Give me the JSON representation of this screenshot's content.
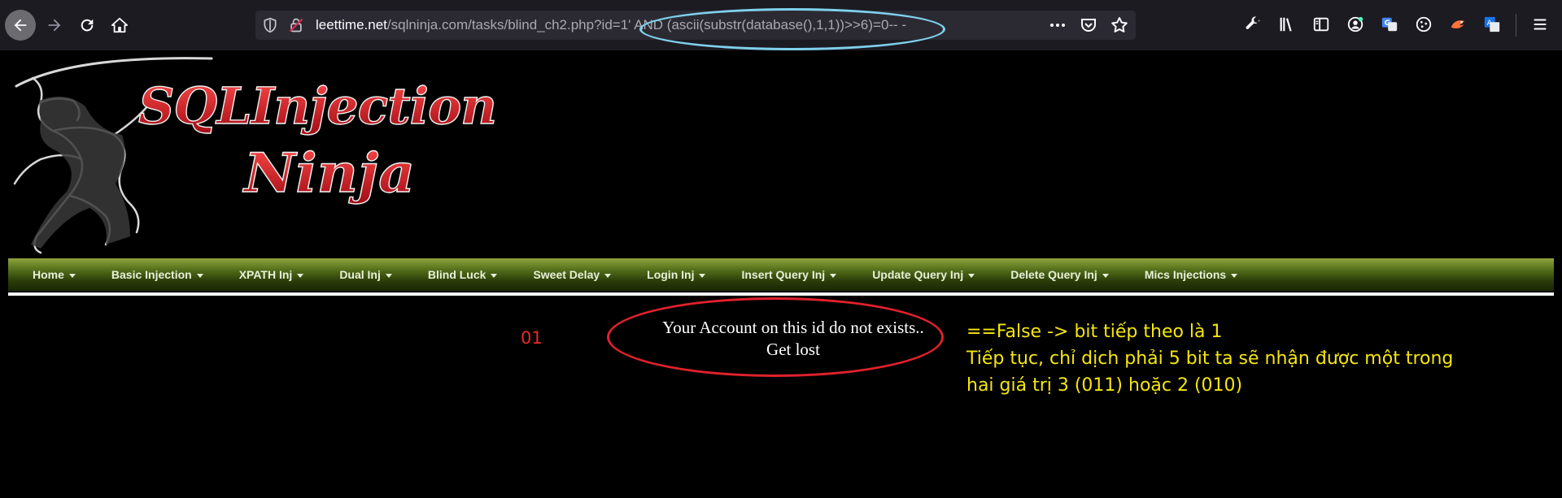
{
  "browser": {
    "url_host": "leettime.net",
    "url_path": "/sqlninja.com/tasks/blind_ch2.php?id=1' AND (ascii(substr(database(),1,1))>>6)=0-- -",
    "icons": {
      "back": "arrow-left-icon",
      "forward": "arrow-right-icon",
      "reload": "reload-icon",
      "home": "home-icon",
      "more": "more-dots-icon",
      "pocket": "pocket-icon",
      "bookmark": "star-icon"
    },
    "toolbar_icons": [
      "wrench-icon",
      "library-icon",
      "sidebar-icon",
      "account-icon",
      "translate-icon",
      "cookie-icon",
      "extension-icon",
      "translate-alt-icon",
      "menu-icon"
    ]
  },
  "banner": {
    "line1": "SQLInjection",
    "line2": "Ninja"
  },
  "menu": {
    "items": [
      {
        "label": "Home"
      },
      {
        "label": "Basic Injection"
      },
      {
        "label": "XPATH Inj"
      },
      {
        "label": "Dual Inj"
      },
      {
        "label": "Blind Luck"
      },
      {
        "label": "Sweet Delay"
      },
      {
        "label": "Login Inj"
      },
      {
        "label": "Insert Query Inj"
      },
      {
        "label": "Update Query Inj"
      },
      {
        "label": "Delete Query Inj"
      },
      {
        "label": "Mics Injections"
      }
    ]
  },
  "content": {
    "bits_label": "01",
    "message_line1": "Your Account on this id do not exists..",
    "message_line2": "Get lost"
  },
  "annotation": {
    "line1": "==False -> bit tiếp theo là 1",
    "line2": "Tiếp tục, chỉ dịch phải 5 bit ta sẽ nhận được một trong",
    "line3": "hai giá trị 3 (011) hoặc 2 (010)"
  },
  "colors": {
    "menu_green": "#4f6b18",
    "annotation_yellow": "#f5e60e",
    "highlight_red": "#e1212c",
    "highlight_cyan": "#7fd1ec",
    "logo_red": "#d01822"
  }
}
